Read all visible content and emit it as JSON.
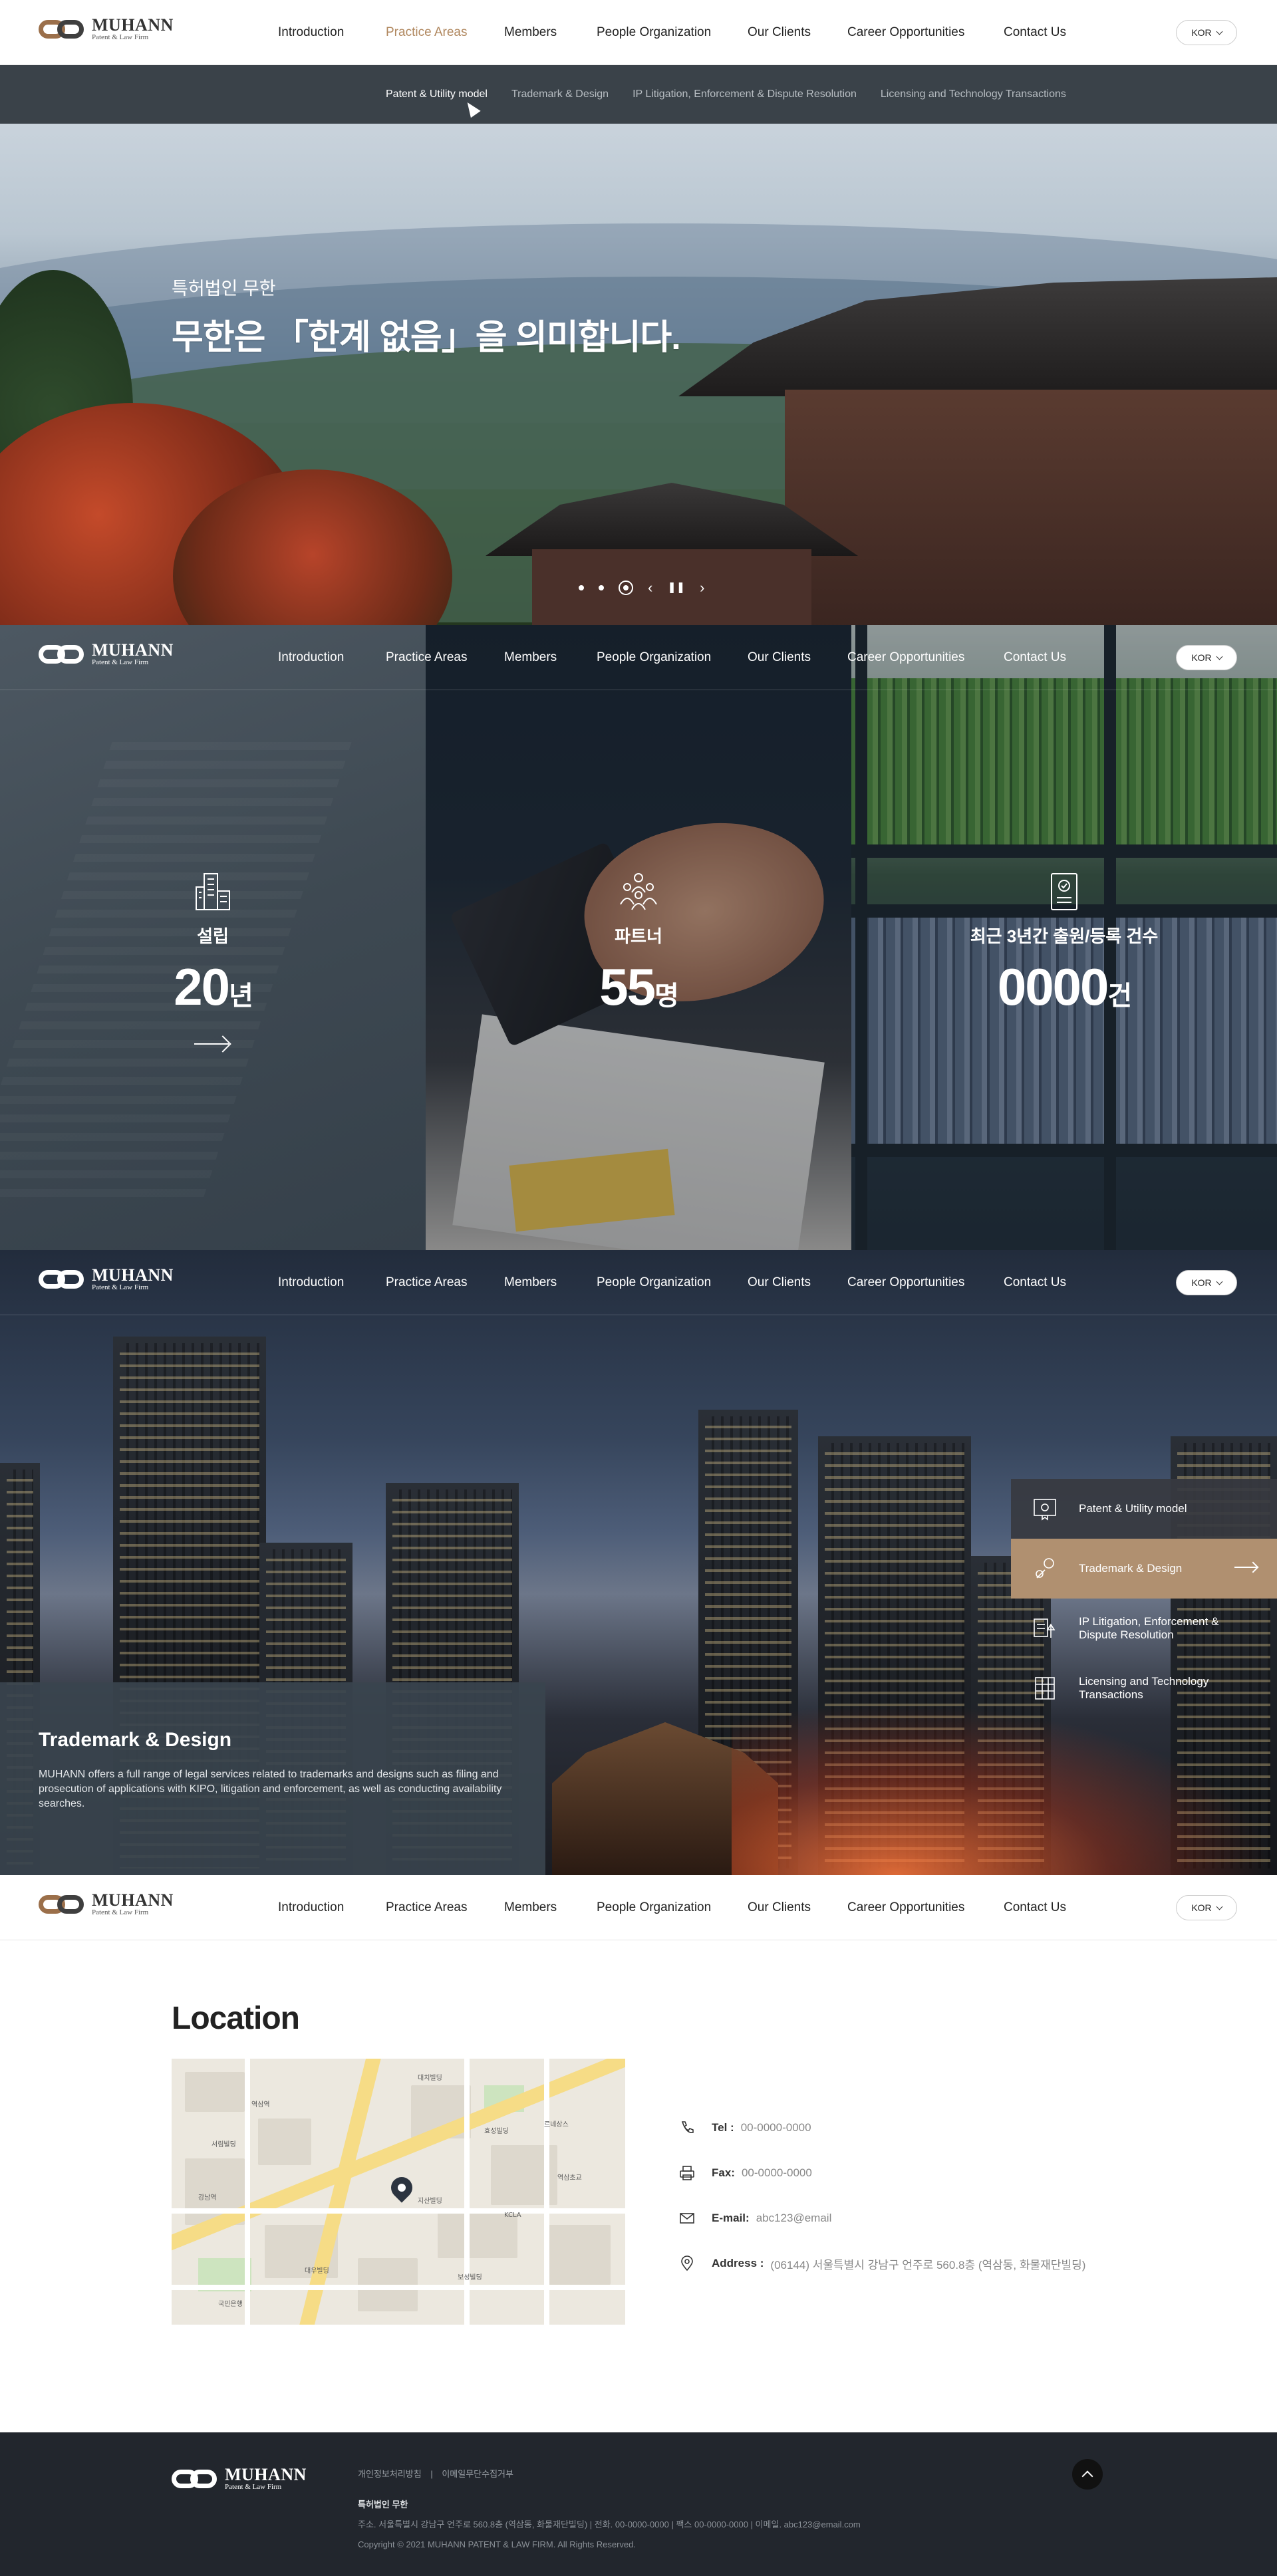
{
  "brand": {
    "name": "MUHANN",
    "tagline": "Patent & Law Firm"
  },
  "nav": {
    "items": [
      "Introduction",
      "Practice Areas",
      "Members",
      "People Organization",
      "Our Clients",
      "Career Opportunities",
      "Contact Us"
    ],
    "active_first_header": "Practice Areas"
  },
  "lang": {
    "label": "KOR"
  },
  "subnav": {
    "items": [
      "Patent & Utility model",
      "Trademark & Design",
      "IP Litigation, Enforcement & Dispute Resolution",
      "Licensing and Technology Transactions"
    ],
    "active": "Patent & Utility model"
  },
  "hero": {
    "subtitle": "특허법인 무한",
    "title": "무한은 「한계 없음」을 의미합니다.",
    "slides": 3,
    "active_slide": 3
  },
  "stats": [
    {
      "label": "설립",
      "value": "20",
      "unit": "년",
      "icon": "building-icon"
    },
    {
      "label": "파트너",
      "value": "55",
      "unit": "명",
      "icon": "people-icon"
    },
    {
      "label": "최근 3년간 출원/등록 건수",
      "value": "0000",
      "unit": "건",
      "icon": "certificate-icon"
    }
  ],
  "practice": {
    "title": "Trademark & Design",
    "description": "MUHANN offers a full range of legal services related to trademarks and designs such as filing and prosecution of applications with KIPO, litigation and enforcement, as well as conducting availability searches.",
    "menu": [
      {
        "label": "Patent & Utility model",
        "icon": "certificate-icon"
      },
      {
        "label": "Trademark & Design",
        "icon": "design-icon"
      },
      {
        "label": "IP Litigation, Enforcement & Dispute Resolution",
        "icon": "scale-icon"
      },
      {
        "label": "Licensing and Technology Transactions",
        "icon": "building-grid-icon"
      }
    ],
    "selected": "Trademark & Design"
  },
  "location": {
    "title": "Location",
    "contacts": [
      {
        "key": "Tel :",
        "value": "00-0000-0000",
        "icon": "phone-icon"
      },
      {
        "key": "Fax:",
        "value": "00-0000-0000",
        "icon": "fax-icon"
      },
      {
        "key": "E-mail:",
        "value": "abc123@email",
        "icon": "mail-icon"
      },
      {
        "key": "Address :",
        "value": "(06144) 서울특별시 강남구 언주로 560.8층 (역삼동, 화물재단빌딩)",
        "icon": "pin-icon"
      }
    ],
    "map_labels": [
      "역삼역",
      "강남역",
      "KCLA",
      "효성빌딩",
      "서림빌딩",
      "대치빌딩",
      "르네상스",
      "역삼초교",
      "지산빌딩",
      "보성빌딩",
      "대우빌딩",
      "국민은행"
    ]
  },
  "footer": {
    "links": [
      "개인정보처리방침",
      "|",
      "이메일무단수집거부"
    ],
    "company": "특허법인 무한",
    "address": "주소. 서울특별시 강남구 언주로 560.8층 (역삼동, 화물재단빌딩)  |  전화. 00-0000-0000  |  팩스 00-0000-0000  |  이메일. abc123@email.com",
    "copyright": "Copyright © 2021 MUHANN PATENT & LAW FIRM. All Rights Reserved."
  }
}
